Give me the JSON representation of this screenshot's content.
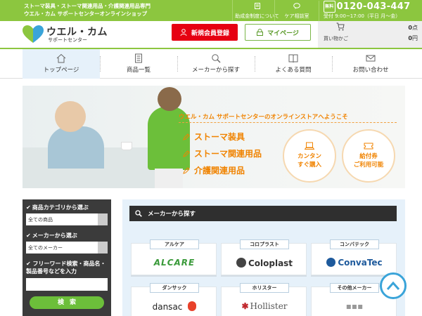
{
  "topbar": {
    "line1": "ストーマ装具・ストーマ関連用品・介護関連用品専門",
    "line2": "ウエル・カム サポートセンターオンラインショップ",
    "subsidy_label": "助成金制度について",
    "consult_label": "ケア相談室",
    "phone_badge": "無料",
    "phone": "0120-043-447",
    "hours": "受付 9:00~17:00（平日 月～金）"
  },
  "header": {
    "logo_main": "ウエル・カム",
    "logo_sub": "サポートセンター",
    "register_label": "新規会員登録",
    "mypage_label": "マイページ",
    "cart_label": "買い物かご",
    "cart_count": "0",
    "cart_count_unit": "点",
    "cart_price": "0",
    "cart_price_unit": "円"
  },
  "nav": {
    "items": [
      {
        "label": "トップページ"
      },
      {
        "label": "商品一覧"
      },
      {
        "label": "メーカーから探す"
      },
      {
        "label": "よくある質問"
      },
      {
        "label": "お問い合わせ"
      }
    ]
  },
  "hero": {
    "welcome": "ウエル・カム サポートセンターのオンラインストアへようこそ",
    "categories": [
      "ストーマ装具",
      "ストーマ関連用品",
      "介護関連用品"
    ],
    "circle1_line1": "カンタン",
    "circle1_line2": "すぐ購入",
    "circle2_line1": "給付券",
    "circle2_line2": "ご利用可能"
  },
  "sidebar": {
    "category_label": "商品カテゴリから選ぶ",
    "category_value": "全ての商品",
    "maker_label": "メーカーから選ぶ",
    "maker_value": "全てのメーカー",
    "freeword_label": "フリーワード検索・商品名・製品番号などを入力",
    "search_button": "検索"
  },
  "maker": {
    "heading": "メーカーから探す",
    "cards": [
      {
        "tag": "アルケア",
        "logo": "ALCARE",
        "color": "#3a9a3a"
      },
      {
        "tag": "コロプラスト",
        "logo": "Coloplast",
        "color": "#333333"
      },
      {
        "tag": "コンバテック",
        "logo": "ConvaTec",
        "color": "#1e5a9c"
      },
      {
        "tag": "ダンサック",
        "logo": "dansac",
        "color": "#222222"
      },
      {
        "tag": "ホリスター",
        "logo": "Hollister",
        "color": "#555555"
      },
      {
        "tag": "その他メーカー",
        "logo": "",
        "color": "#999999"
      }
    ]
  },
  "colors": {
    "green": "#8cc63f",
    "red": "#e60012",
    "orange": "#f08300",
    "blue": "#3aa4d9"
  }
}
